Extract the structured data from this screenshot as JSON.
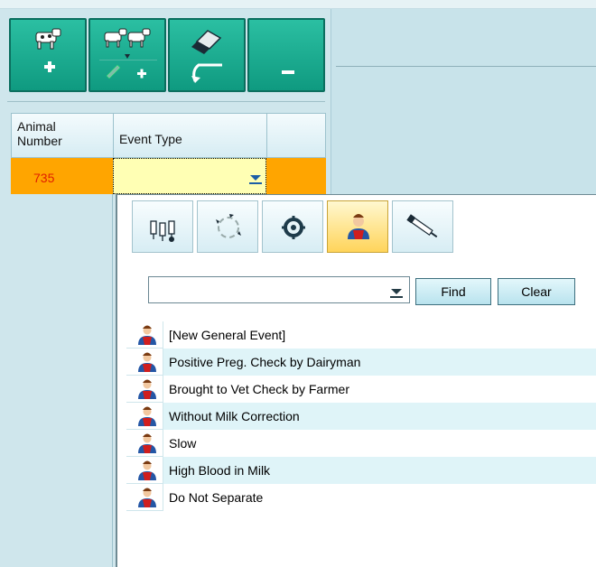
{
  "toolbar": {
    "buttons": [
      {
        "name": "add-animal-button",
        "icon": "cow-add-icon"
      },
      {
        "name": "edit-add-animals-button",
        "icon": "cows-edit-add-icon"
      },
      {
        "name": "undo-button",
        "icon": "eraser-undo-icon"
      },
      {
        "name": "remove-button",
        "icon": "minus-icon"
      }
    ]
  },
  "grid": {
    "columns": [
      "Animal\nNumber",
      "Event Type",
      ""
    ],
    "rows": [
      {
        "animal_number": "735",
        "event_type": ""
      }
    ],
    "colors": {
      "selected_row": "#ffa500",
      "animal_number_text": "#e02000",
      "editor_bg": "#ffffb4"
    }
  },
  "popup": {
    "tabs": [
      {
        "icon": "milking-cups-icon",
        "active": false
      },
      {
        "icon": "cycle-arrows-icon",
        "active": false
      },
      {
        "icon": "gear-icon",
        "active": false
      },
      {
        "icon": "farmer-icon",
        "active": true
      },
      {
        "icon": "syringe-icon",
        "active": false
      }
    ],
    "search": {
      "value": "",
      "placeholder": ""
    },
    "find_label": "Find",
    "clear_label": "Clear",
    "events": [
      "[New General Event]",
      "Positive Preg. Check by Dairyman",
      "Brought to Vet Check by Farmer",
      "Without Milk Correction",
      "Slow",
      "High Blood in Milk",
      "Do Not Separate"
    ]
  },
  "colors": {
    "accent": "#15a88a",
    "active_tab": "#ffd45a",
    "list_alt_row": "#dff4f8"
  }
}
